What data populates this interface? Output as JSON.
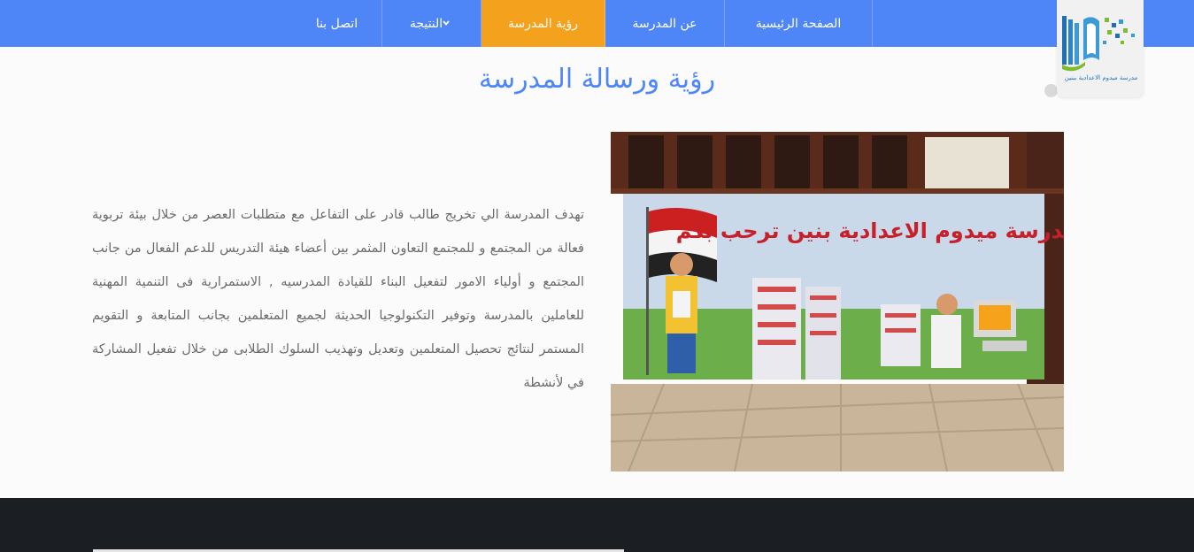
{
  "nav": {
    "items": [
      {
        "label": "اتصل بنا"
      },
      {
        "label": "النتيجة",
        "has_dropdown": true
      },
      {
        "label": "رؤية المدرسة",
        "active": true
      },
      {
        "label": "عن المدرسة"
      },
      {
        "label": "الصفحة الرئيسية"
      }
    ],
    "dropdown_icon": "chevron-down-icon",
    "accent_color": "#4f86f7",
    "active_color": "#f4a21d"
  },
  "logo": {
    "caption": "مدرسة ميدوم الاعدادية ببنين"
  },
  "section": {
    "title": "رؤية ورسالة المدرسة",
    "body": "تهدف المدرسة الي تخريج طالب قادر على التفاعل مع متطلبات العصر من خلال بيئة تربوية فعالة من المجتمع و للمجتمع التعاون المثمر بين أعضاء هيئة التدريس للدعم الفعال من جانب المجتمع و أولياء الامور لتفعيل البناء للقيادة المدرسيه , الاستمرارية فى التنمية المهنية للعاملين بالمدرسة وتوفير التكنولوجيا الحديثة لجميع المتعلمين بجانب المتابعة و التقويم المستمر لنتائج تحصيل المتعلمين وتعديل وتهذيب السلوك الطلابى من خلال تفعيل المشاركة في لأنشطة"
  },
  "mural": {
    "sign_text": "مدرسة ميدوم الاعدادية بنين ترحب بكم"
  },
  "colors": {
    "footer": "#1b1e22",
    "text": "#6b6b6b"
  }
}
